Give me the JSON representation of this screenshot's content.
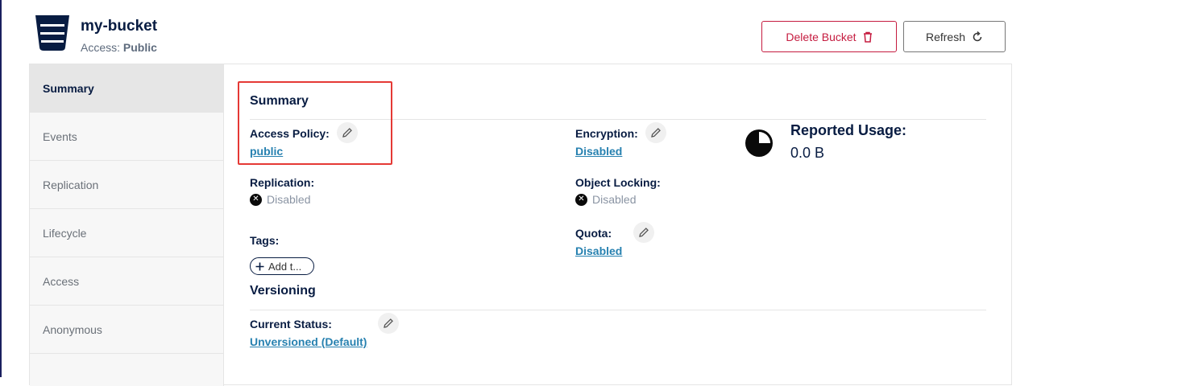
{
  "header": {
    "bucket_name": "my-bucket",
    "access_label": "Access:",
    "access_value": "Public",
    "icon": "bucket-icon"
  },
  "toolbar": {
    "delete_label": "Delete Bucket",
    "delete_icon": "trash-icon",
    "refresh_label": "Refresh",
    "refresh_icon": "refresh-icon"
  },
  "sidebar": {
    "items": [
      {
        "label": "Summary",
        "active": true
      },
      {
        "label": "Events"
      },
      {
        "label": "Replication"
      },
      {
        "label": "Lifecycle"
      },
      {
        "label": "Access"
      },
      {
        "label": "Anonymous"
      }
    ]
  },
  "summary": {
    "heading": "Summary",
    "access_policy": {
      "label": "Access Policy:",
      "value": "public"
    },
    "encryption": {
      "label": "Encryption:",
      "value": "Disabled"
    },
    "replication": {
      "label": "Replication:",
      "value": "Disabled"
    },
    "object_locking": {
      "label": "Object Locking:",
      "value": "Disabled"
    },
    "tags": {
      "label": "Tags:",
      "add_label": "Add t..."
    },
    "quota": {
      "label": "Quota:",
      "value": "Disabled"
    },
    "reported_usage": {
      "label": "Reported Usage:",
      "value": "0.0 B",
      "icon": "pie-chart-icon"
    }
  },
  "versioning": {
    "heading": "Versioning",
    "current_status": {
      "label": "Current Status:",
      "value": "Unversioned (Default)"
    }
  },
  "colors": {
    "danger": "#c51b3f",
    "link": "#2781b0",
    "highlight": "#e53935",
    "text": "#081c42"
  }
}
